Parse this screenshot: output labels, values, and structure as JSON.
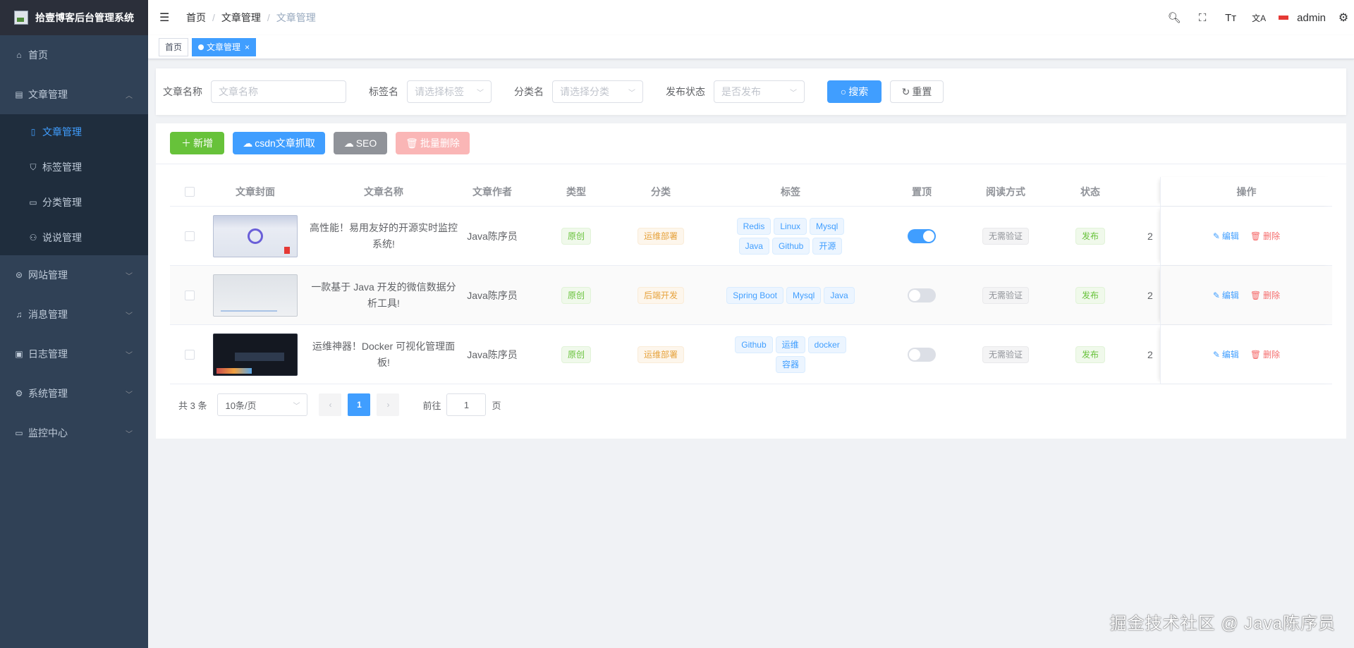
{
  "app": {
    "title": "拾壹博客后台管理系统"
  },
  "sidebar": {
    "items": [
      {
        "label": "首页",
        "icon": "home-icon"
      },
      {
        "label": "文章管理",
        "icon": "article-icon",
        "expanded": true,
        "children": [
          {
            "label": "文章管理",
            "icon": "document-icon",
            "active": true
          },
          {
            "label": "标签管理",
            "icon": "bookmark-icon"
          },
          {
            "label": "分类管理",
            "icon": "folder-icon"
          },
          {
            "label": "说说管理",
            "icon": "bicycle-icon"
          }
        ]
      },
      {
        "label": "网站管理",
        "icon": "website-icon"
      },
      {
        "label": "消息管理",
        "icon": "bell-icon"
      },
      {
        "label": "日志管理",
        "icon": "log-icon"
      },
      {
        "label": "系统管理",
        "icon": "gear-icon"
      },
      {
        "label": "监控中心",
        "icon": "monitor-icon"
      }
    ]
  },
  "navbar": {
    "breadcrumb": [
      "首页",
      "文章管理",
      "文章管理"
    ],
    "username": "admin",
    "size_icon_label": "Tт",
    "lang_icon_label": "文A"
  },
  "tags_view": {
    "tags": [
      "首页",
      "文章管理"
    ]
  },
  "search": {
    "title_label": "文章名称",
    "title_placeholder": "文章名称",
    "tag_label": "标签名",
    "tag_placeholder": "请选择标签",
    "category_label": "分类名",
    "category_placeholder": "请选择分类",
    "status_label": "发布状态",
    "status_placeholder": "是否发布",
    "search_btn": "搜索",
    "reset_btn": "重置"
  },
  "toolbar": {
    "add": "新增",
    "csdn": "csdn文章抓取",
    "seo": "SEO",
    "batch_delete": "批量删除"
  },
  "table": {
    "headers": {
      "cover": "文章封面",
      "name": "文章名称",
      "author": "文章作者",
      "type": "类型",
      "category": "分类",
      "tags": "标签",
      "top": "置顶",
      "read": "阅读方式",
      "status": "状态",
      "ops": "操作"
    },
    "rows": [
      {
        "name": "高性能！易用友好的开源实时监控系统!",
        "author": "Java陈序员",
        "type": "原创",
        "category": "运维部署",
        "tags": [
          "Redis",
          "Linux",
          "Mysql",
          "Java",
          "Github",
          "开源"
        ],
        "top": true,
        "read": "无需验证",
        "status": "发布",
        "extra": "2",
        "edit": "编辑",
        "delete": "删除"
      },
      {
        "name": "一款基于 Java 开发的微信数据分析工具!",
        "author": "Java陈序员",
        "type": "原创",
        "category": "后端开发",
        "tags": [
          "Spring Boot",
          "Mysql",
          "Java"
        ],
        "top": false,
        "read": "无需验证",
        "status": "发布",
        "extra": "2",
        "edit": "编辑",
        "delete": "删除"
      },
      {
        "name": "运维神器！Docker 可视化管理面板!",
        "author": "Java陈序员",
        "type": "原创",
        "category": "运维部署",
        "tags": [
          "Github",
          "运维",
          "docker",
          "容器"
        ],
        "top": false,
        "read": "无需验证",
        "status": "发布",
        "extra": "2",
        "edit": "编辑",
        "delete": "删除"
      }
    ]
  },
  "pagination": {
    "total_text": "共 3 条",
    "page_size": "10条/页",
    "current": "1",
    "goto_label": "前往",
    "goto_value": "1",
    "page_unit": "页"
  },
  "watermark": "掘金技术社区 @ Java陈序员",
  "colors": {
    "primary": "#409eff",
    "sidebar_bg": "#304156",
    "success": "#67c23a",
    "danger": "#f56c6c",
    "warning": "#e6a23c"
  }
}
